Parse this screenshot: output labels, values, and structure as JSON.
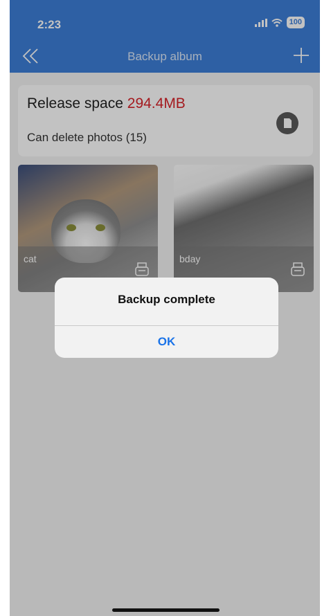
{
  "status": {
    "time": "2:23",
    "battery": "100"
  },
  "nav": {
    "title": "Backup album"
  },
  "info": {
    "release_label": "Release space",
    "release_size": "294.4MB",
    "delete_label": "Can delete photos (15)"
  },
  "photos": [
    {
      "label": "cat"
    },
    {
      "label": "bday"
    }
  ],
  "alert": {
    "title": "Backup complete",
    "ok_label": "OK"
  },
  "colors": {
    "accent": "#3d7fd8",
    "size_red": "#d8232a",
    "ok_blue": "#1a73e8"
  }
}
